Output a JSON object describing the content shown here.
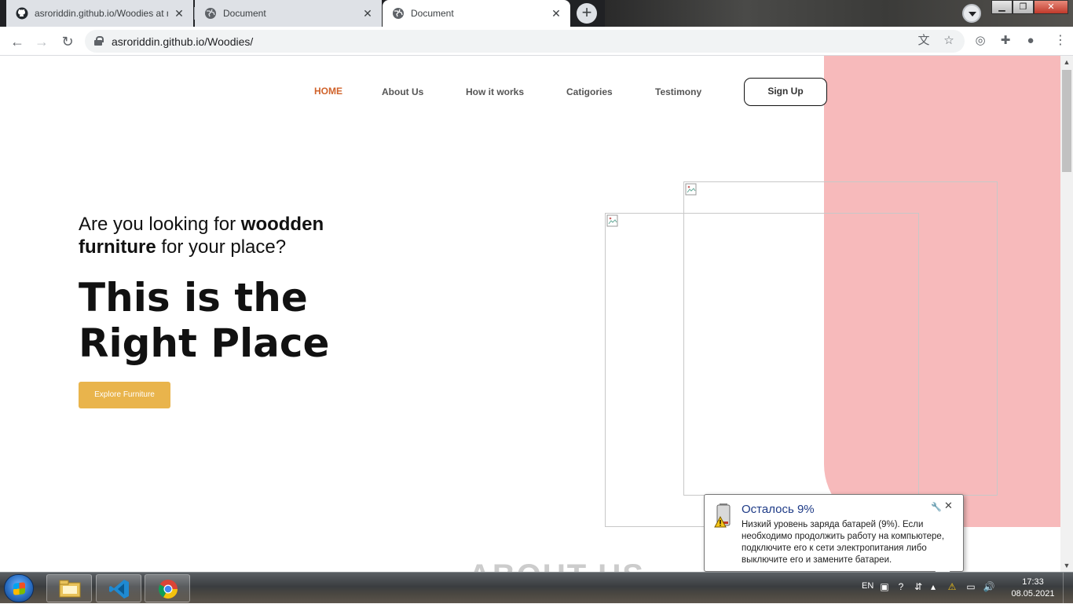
{
  "browser": {
    "tabs": [
      {
        "title": "asroriddin.github.io/Woodies at m",
        "icon": "github-icon",
        "active": false
      },
      {
        "title": "Document",
        "icon": "globe-icon",
        "active": false
      },
      {
        "title": "Document",
        "icon": "globe-icon",
        "active": true
      }
    ],
    "url": "asroriddin.github.io/Woodies/",
    "new_tab_symbol": "+"
  },
  "page": {
    "nav": {
      "home": "HOME",
      "about": "About Us",
      "how": "How it works",
      "categories": "Catigories",
      "testimony": "Testimony",
      "signup": "Sign Up"
    },
    "hero": {
      "sub_part1": "Are you looking for ",
      "sub_bold1": "woodden",
      "sub_bold2": "furniture",
      "sub_part2": " for your place?",
      "title_line1": "This is the",
      "title_line2": "Right Place",
      "cta": "Explore Furniture"
    },
    "ghost_heading": "ABOUT US",
    "colors": {
      "accent_orange": "#d0632b",
      "button_gold": "#e9b44c",
      "pink_panel": "#f7babb"
    }
  },
  "balloon": {
    "title": "Осталось 9%",
    "body": "Низкий уровень заряда батарей (9%). Если необходимо продолжить работу на компьютере, подключите его к сети электропитания либо выключите его и замените батареи."
  },
  "taskbar": {
    "language": "EN",
    "time": "17:33",
    "date": "08.05.2021",
    "apps": [
      "file-explorer-icon",
      "vscode-icon",
      "chrome-icon"
    ]
  }
}
